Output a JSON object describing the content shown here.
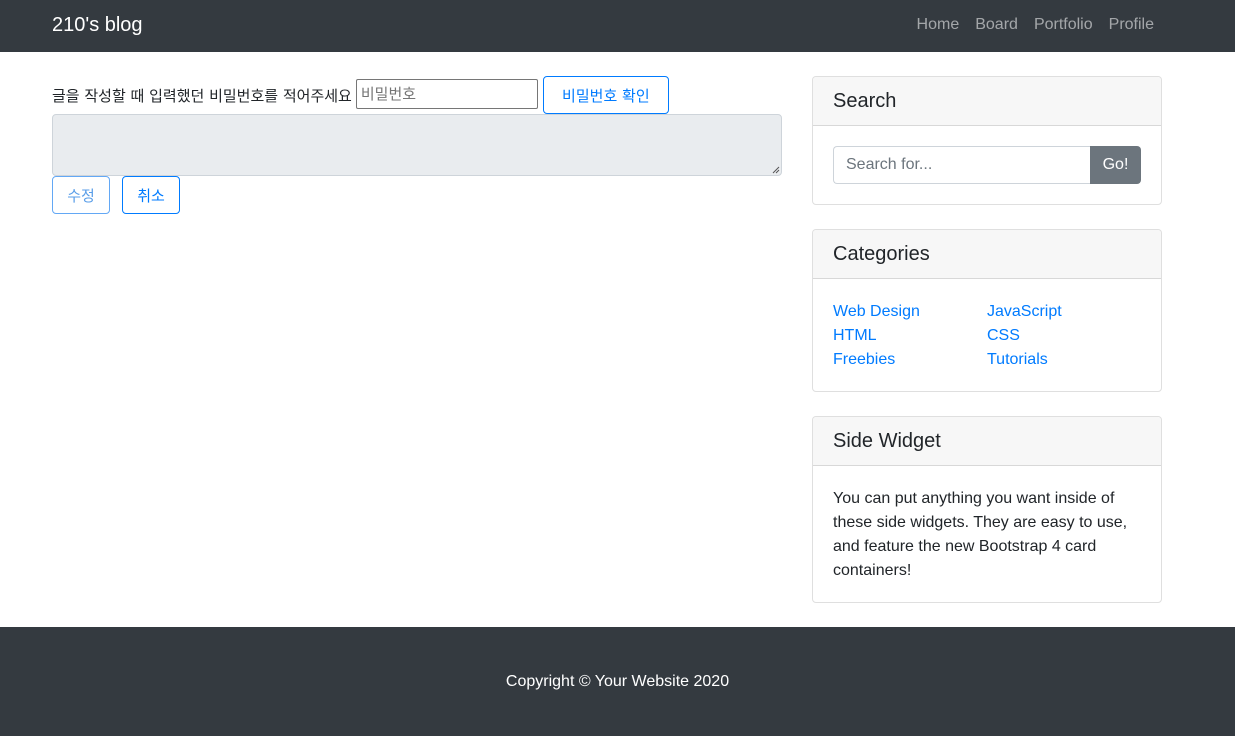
{
  "navbar": {
    "brand": "210's blog",
    "links": [
      "Home",
      "Board",
      "Portfolio",
      "Profile"
    ]
  },
  "password_form": {
    "label": "글을 작성할 때 입력했던 비밀번호를 적어주세요",
    "input_placeholder": "비밀번호",
    "input_value": "",
    "confirm_label": "비밀번호 확인"
  },
  "editor": {
    "content": ""
  },
  "actions": {
    "edit_label": "수정",
    "cancel_label": "취소"
  },
  "sidebar": {
    "search": {
      "title": "Search",
      "placeholder": "Search for...",
      "button_label": "Go!"
    },
    "categories": {
      "title": "Categories",
      "left": [
        "Web Design",
        "HTML",
        "Freebies"
      ],
      "right": [
        "JavaScript",
        "CSS",
        "Tutorials"
      ]
    },
    "widget": {
      "title": "Side Widget",
      "text": "You can put anything you want inside of these side widgets. They are easy to use, and feature the new Bootstrap 4 card containers!"
    }
  },
  "footer": {
    "text": "Copyright © Your Website 2020"
  },
  "colors": {
    "navbar_bg": "#343a40",
    "link_blue": "#007bff",
    "button_gray": "#6c757d"
  }
}
